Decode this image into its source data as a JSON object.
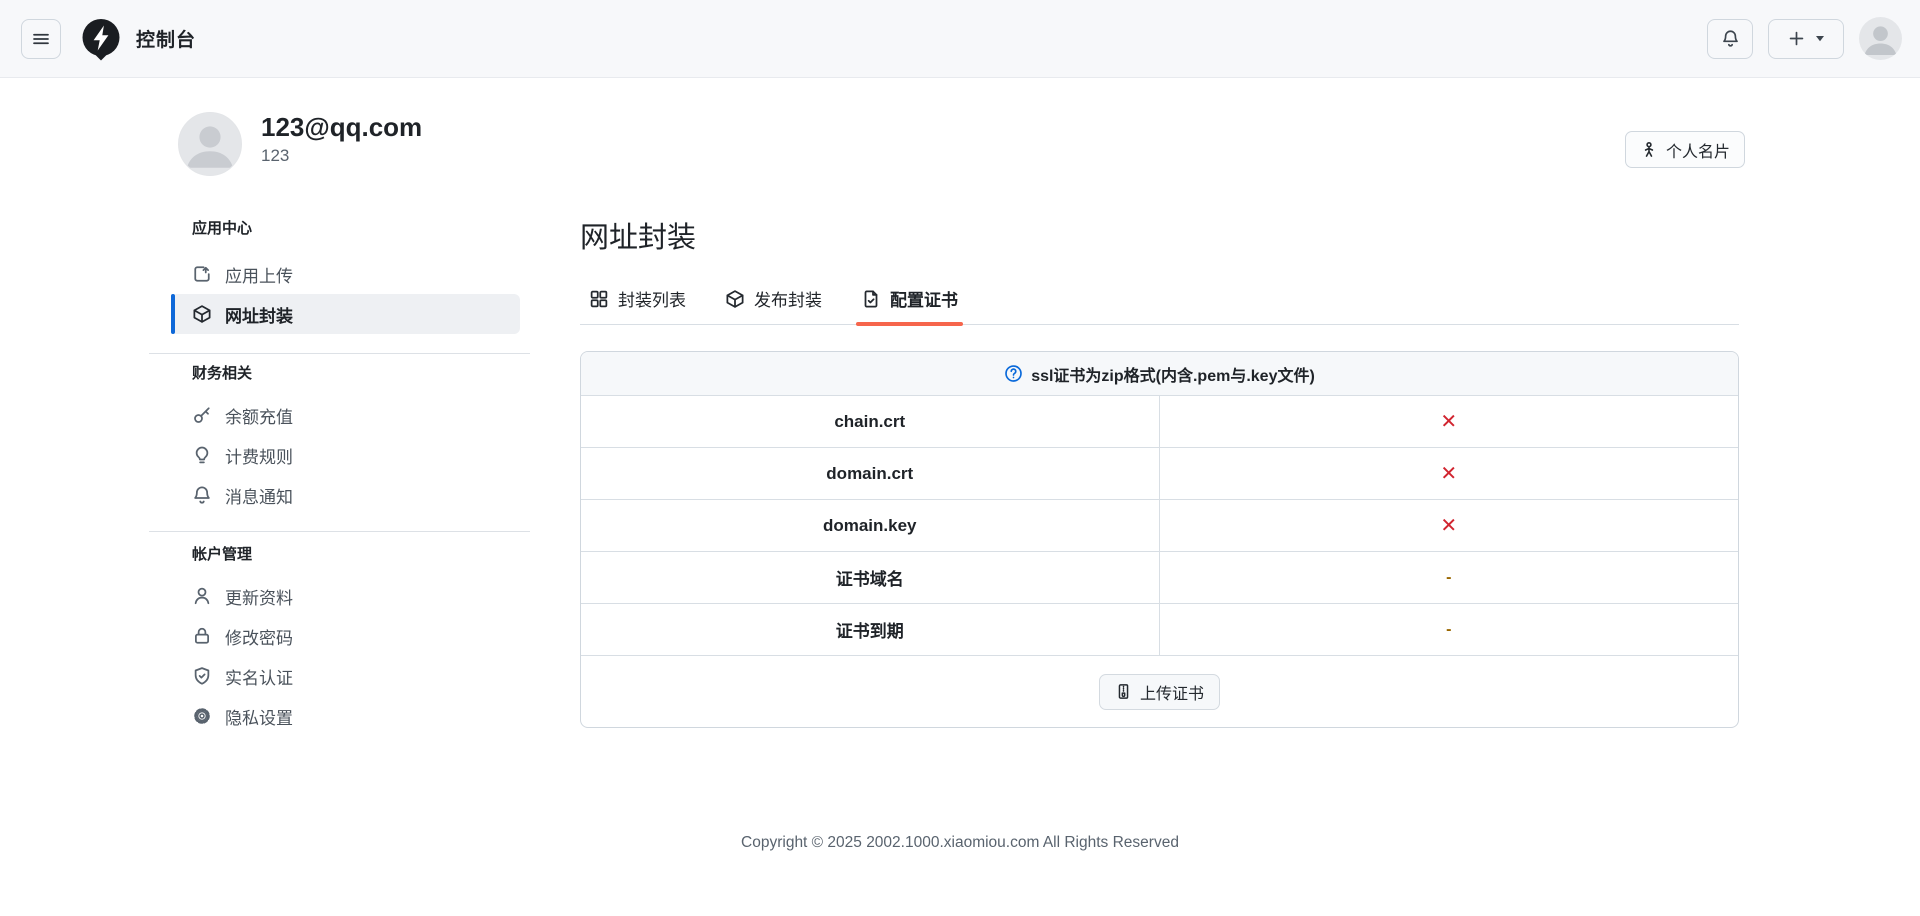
{
  "header": {
    "title": "控制台"
  },
  "profile": {
    "email": "123@qq.com",
    "name": "123",
    "vcard_label": "个人名片"
  },
  "sidebar": {
    "sections": [
      {
        "label": "应用中心",
        "items": [
          {
            "label": "应用上传",
            "icon": "upload-icon",
            "active": false
          },
          {
            "label": "网址封装",
            "icon": "package-icon",
            "active": true
          }
        ]
      },
      {
        "label": "财务相关",
        "items": [
          {
            "label": "余额充值",
            "icon": "key-icon",
            "active": false
          },
          {
            "label": "计费规则",
            "icon": "bulb-icon",
            "active": false
          },
          {
            "label": "消息通知",
            "icon": "bell-icon",
            "active": false
          }
        ]
      },
      {
        "label": "帐户管理",
        "items": [
          {
            "label": "更新资料",
            "icon": "person-icon",
            "active": false
          },
          {
            "label": "修改密码",
            "icon": "lock-icon",
            "active": false
          },
          {
            "label": "实名认证",
            "icon": "shield-icon",
            "active": false
          },
          {
            "label": "隐私设置",
            "icon": "gear-icon",
            "active": false
          }
        ]
      }
    ]
  },
  "main": {
    "title": "网址封装",
    "tabs": [
      {
        "label": "封装列表",
        "icon": "grid-icon",
        "active": false
      },
      {
        "label": "发布封装",
        "icon": "package-icon",
        "active": false
      },
      {
        "label": "配置证书",
        "icon": "file-check-icon",
        "active": true
      }
    ],
    "cert_panel": {
      "notice": "ssl证书为zip格式(内含.pem与.key文件)",
      "rows": [
        {
          "label": "chain.crt",
          "status": "missing",
          "symbol": "✕"
        },
        {
          "label": "domain.crt",
          "status": "missing",
          "symbol": "✕"
        },
        {
          "label": "domain.key",
          "status": "missing",
          "symbol": "✕"
        },
        {
          "label": "证书域名",
          "status": "empty",
          "symbol": "-"
        },
        {
          "label": "证书到期",
          "status": "empty",
          "symbol": "-"
        }
      ],
      "upload_label": "上传证书"
    }
  },
  "footer": {
    "copyright": "Copyright © 2025 2002.1000.xiaomiou.com All Rights Reserved"
  },
  "colors": {
    "accent_blue": "#0969da",
    "danger_red": "#d1242f",
    "warn_yellow": "#9a6700",
    "tab_underline": "#f6654c",
    "active_bar_blue": "#0e68d8"
  }
}
